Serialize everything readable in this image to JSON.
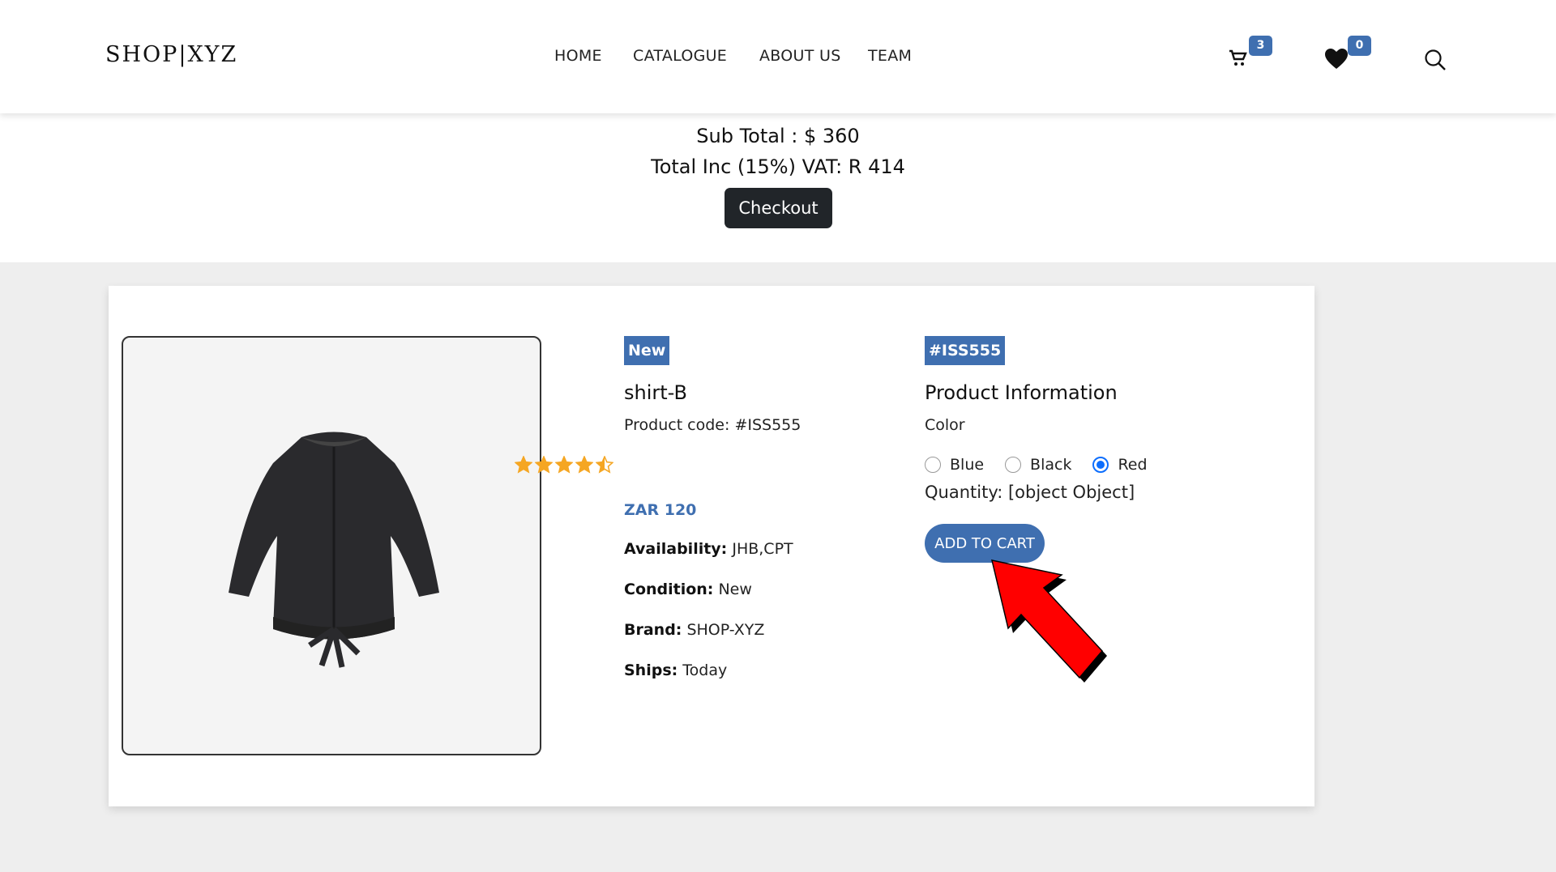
{
  "header": {
    "brand": "SHOP|XYZ",
    "nav": [
      "HOME",
      "CATALOGUE",
      "ABOUT US",
      "TEAM"
    ],
    "cart_icon": "cart-icon",
    "cart_count": "3",
    "wishlist_icon": "heart-icon",
    "wishlist_count": "0",
    "search_icon": "search-icon"
  },
  "summary": {
    "subtotal": "Sub Total : $ 360",
    "total": "Total Inc (15%) VAT: R 414",
    "checkout_label": "Checkout"
  },
  "product": {
    "badge": "New",
    "name": "shirt-B",
    "code": "Product code: #ISS555",
    "rating": 4.5,
    "rating_max": 5,
    "price": "ZAR 120",
    "availability_label": "Availability:",
    "availability": "JHB,CPT",
    "condition_label": "Condition:",
    "condition": "New",
    "brand_label": "Brand:",
    "brand": "SHOP-XYZ",
    "ships_label": "Ships:",
    "ships": "Today"
  },
  "info": {
    "code_badge": "#ISS555",
    "title": "Product Information",
    "color_label": "Color",
    "colors": [
      "Blue",
      "Black",
      "Red"
    ],
    "selected_color": "Red",
    "quantity": "Quantity: [object Object]",
    "add_to_cart": "ADD TO CART"
  },
  "colors": {
    "accent": "#3f6fb0",
    "dark_button": "#212529",
    "star": "#f5a623",
    "radio_checked": "#0d6efd",
    "annotation_arrow": "#ff0000"
  }
}
